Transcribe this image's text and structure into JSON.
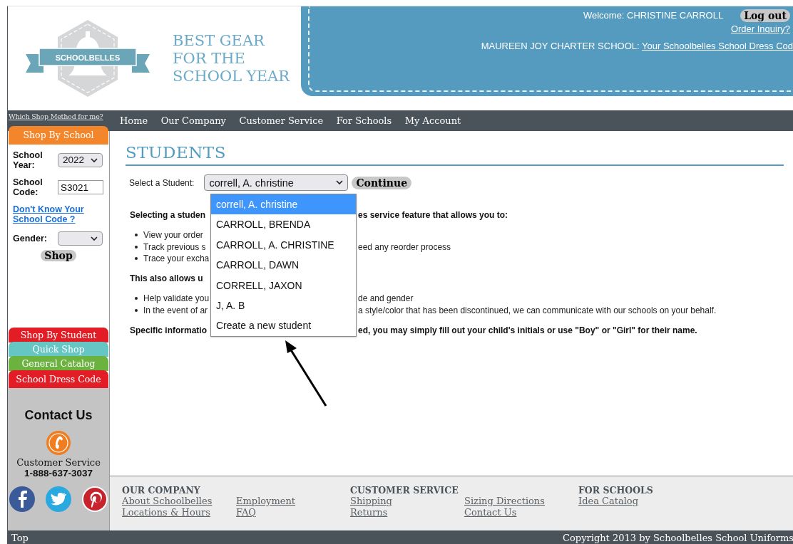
{
  "header": {
    "logo_text": "SCHOOLBELLES",
    "tagline": "BEST GEAR\nFOR THE\nSCHOOL YEAR",
    "welcome": "Welcome: CHRISTINE CARROLL",
    "logout_button": "Log out",
    "order_inquiry_link": "Order Inquiry?",
    "school_label": "MAUREEN JOY CHARTER SCHOOL:",
    "dress_code_link": "Your Schoolbelles School Dress Cod"
  },
  "nav": {
    "shop_method_link": "Which Shop Method for me?",
    "items": [
      "Home",
      "Our Company",
      "Customer Service",
      "For Schools",
      "My Account"
    ]
  },
  "sidebar": {
    "active_tab": "Shop By School",
    "school_year": {
      "label": "School Year:",
      "value": "2022"
    },
    "school_code": {
      "label": "School Code:",
      "value": "S3021"
    },
    "help_link": "Don't Know Your School Code ?",
    "gender": {
      "label": "Gender:"
    },
    "shop_button": "Shop",
    "tabs": [
      {
        "label": "Shop By Student",
        "color": "#e31d25"
      },
      {
        "label": "Quick Shop",
        "color": "#66c6c3"
      },
      {
        "label": "General Catalog",
        "color": "#6bb23e"
      },
      {
        "label": "School Dress Code",
        "color": "#e31d25"
      }
    ],
    "contact": {
      "title": "Contact Us",
      "service": "Customer Service",
      "phone": "1-888-637-3037"
    }
  },
  "main": {
    "title": "STUDENTS",
    "select_label": "Select a Student:",
    "select_value": "correll, A. christine",
    "continue_button": "Continue",
    "options": [
      {
        "label": "correll, A. christine",
        "selected": true
      },
      {
        "label": "CARROLL, BRENDA",
        "selected": false
      },
      {
        "label": "CARROLL, A. CHRISTINE",
        "selected": false
      },
      {
        "label": "CARROLL, DAWN",
        "selected": false
      },
      {
        "label": "CORRELL, JAXON",
        "selected": false
      },
      {
        "label": "J, A. B",
        "selected": false
      },
      {
        "label": "Create a new student",
        "selected": false
      }
    ],
    "info_lines": [
      {
        "kind": "heading",
        "left": "Selecting a studen",
        "right": "es service feature that allows you to:"
      },
      {
        "kind": "bullet",
        "left": "View your order"
      },
      {
        "kind": "bullet",
        "left": "Track previous s",
        "right": "eed any reorder process"
      },
      {
        "kind": "bullet",
        "left": "Trace your excha"
      },
      {
        "kind": "heading",
        "left": "This also allows u"
      },
      {
        "kind": "bullet",
        "left": "Help validate you",
        "right": "de and gender"
      },
      {
        "kind": "bullet",
        "left": "In the event of ar",
        "right": "a style/color that has been discontinued, we can communicate with our schools on your behalf."
      },
      {
        "kind": "heading",
        "left": "Specific informatio",
        "right": "ed, you may simply fill out your child's initials or use \"Boy\" or \"Girl\" for their name."
      }
    ]
  },
  "footer": {
    "columns": [
      {
        "heading": "OUR COMPANY",
        "links": [
          "About Schoolbelles",
          "Employment",
          "Locations & Hours",
          "FAQ"
        ]
      },
      {
        "heading": "CUSTOMER SERVICE",
        "links": [
          "Shipping",
          "Sizing Directions",
          "Returns",
          "Contact Us"
        ]
      },
      {
        "heading": "FOR SCHOOLS",
        "links": [
          "Idea Catalog"
        ]
      }
    ]
  },
  "bottom_bar": {
    "top_link": "Top",
    "copyright": "Copyright 2013 by Schoolbelles School Uniforms"
  }
}
